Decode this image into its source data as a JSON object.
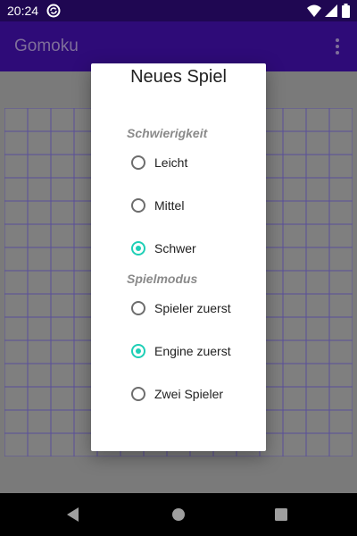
{
  "status_bar": {
    "time": "20:24"
  },
  "app_bar": {
    "title": "Gomoku",
    "menu_icon": "more-vert-icon"
  },
  "board": {
    "rows": 15,
    "cols": 15,
    "line_color": "#5a4f9a"
  },
  "dialog": {
    "title": "Neues Spiel",
    "difficulty": {
      "label": "Schwierigkeit",
      "options": [
        {
          "label": "Leicht",
          "checked": false
        },
        {
          "label": "Mittel",
          "checked": false
        },
        {
          "label": "Schwer",
          "checked": true
        }
      ]
    },
    "mode": {
      "label": "Spielmodus",
      "options": [
        {
          "label": "Spieler zuerst",
          "checked": false
        },
        {
          "label": "Engine zuerst",
          "checked": true
        },
        {
          "label": "Zwei Spieler",
          "checked": false
        }
      ]
    }
  },
  "colors": {
    "accent": "#1ecfb6",
    "primary": "#2e0b78",
    "primary_dark": "#1f0752"
  }
}
